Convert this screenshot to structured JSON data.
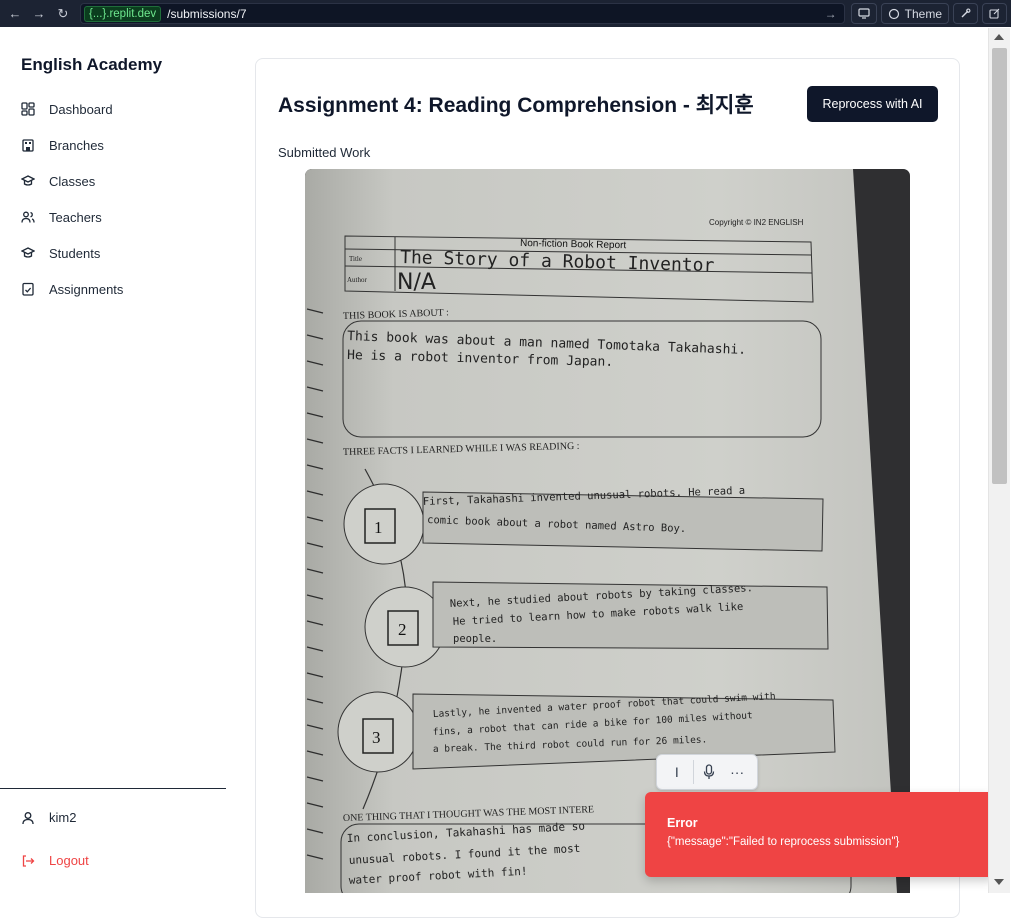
{
  "browser": {
    "domain": "{...}.replit.dev",
    "path": "/submissions/7",
    "theme_label": "Theme"
  },
  "sidebar": {
    "brand": "English Academy",
    "items": [
      {
        "label": "Dashboard",
        "icon": "dashboard-icon"
      },
      {
        "label": "Branches",
        "icon": "building-icon"
      },
      {
        "label": "Classes",
        "icon": "graduation-cap-icon"
      },
      {
        "label": "Teachers",
        "icon": "users-icon"
      },
      {
        "label": "Students",
        "icon": "graduation-cap-icon"
      },
      {
        "label": "Assignments",
        "icon": "clipboard-check-icon"
      }
    ],
    "user": "kim2",
    "logout": "Logout"
  },
  "main": {
    "title": "Assignment 4: Reading Comprehension - 최지훈",
    "reprocess_label": "Reprocess with AI",
    "submitted_label": "Submitted Work"
  },
  "worksheet": {
    "copyright": "Copyright © IN2 ENGLISH",
    "heading": "Non-fiction Book Report",
    "title_label": "Title",
    "author_label": "Author",
    "title_value": "The Story of a Robot Inventor",
    "author_value": "N/A",
    "about_label": "THIS BOOK IS ABOUT :",
    "about_text": [
      "This book was about a man named Tomotaka Takahashi.",
      "He is a robot inventor from Japan."
    ],
    "facts_label": "THREE FACTS I LEARNED WHILE I WAS READING :",
    "facts": [
      {
        "num": "1",
        "lines": [
          "First, Takahashi invented unusual robots. He read a",
          "comic book about a robot named Astro Boy."
        ]
      },
      {
        "num": "2",
        "lines": [
          "Next, he studied about robots by taking classes.",
          "He tried to learn how to make robots walk like",
          "people."
        ]
      },
      {
        "num": "3",
        "lines": [
          "Lastly, he invented a water proof robot that could swim with",
          "fins, a robot that can ride a bike for 100 miles without",
          "a break. The third robot could run for 26 miles."
        ]
      }
    ],
    "thought_label": "ONE THING THAT I THOUGHT WAS THE MOST INTERE",
    "thought_text": [
      "In conclusion, Takahashi has made so",
      "unusual robots. I found it the most",
      "water proof robot with fin!"
    ]
  },
  "floatbar": {
    "cursor": "I",
    "more": "···"
  },
  "toast": {
    "title": "Error",
    "message": "{\"message\":\"Failed to reprocess submission\"}"
  },
  "colors": {
    "toast_bg": "#ef4444",
    "primary_button": "#0f172a",
    "logout": "#ef4444"
  }
}
